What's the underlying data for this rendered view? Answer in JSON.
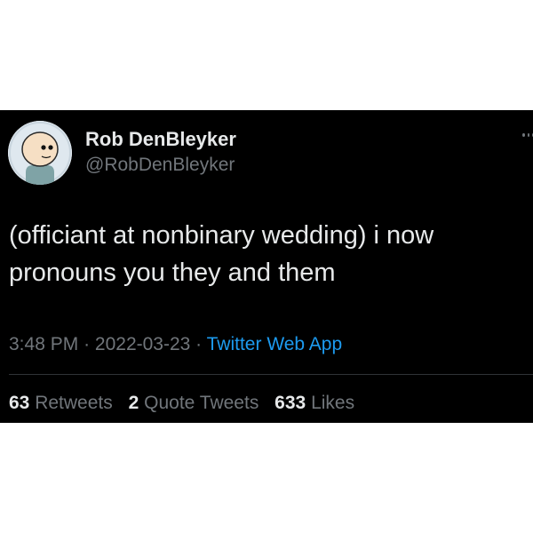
{
  "tweet": {
    "author": {
      "name": "Rob DenBleyker",
      "handle": "@RobDenBleyker"
    },
    "text_lines": [
      "(officiant at nonbinary wedding) i now",
      "pronouns you they and them"
    ],
    "meta": {
      "time": "3:48 PM",
      "separator": "·",
      "date": "2022-03-23",
      "source": "Twitter Web App"
    },
    "stats": {
      "retweets_count": "63",
      "retweets_label": "Retweets",
      "quotes_count": "2",
      "quotes_label": "Quote Tweets",
      "likes_count": "633",
      "likes_label": "Likes"
    }
  },
  "colors": {
    "background": "#000000",
    "text": "#e7e9ea",
    "secondary": "#71767b",
    "link": "#1d9bf0"
  },
  "icons": {
    "avatar": "cartoon-face-avatar",
    "more": "more-options-icon"
  }
}
